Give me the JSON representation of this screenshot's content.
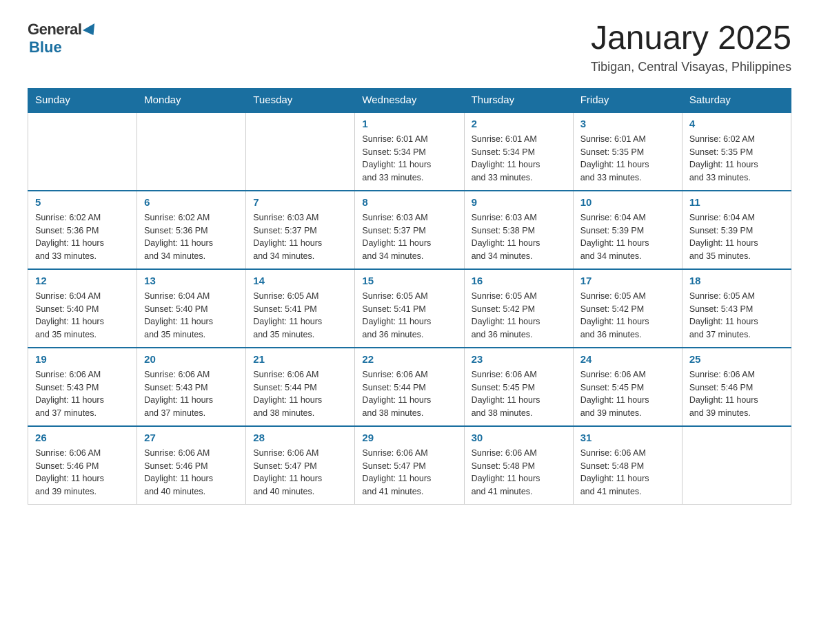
{
  "logo": {
    "general": "General",
    "blue": "Blue"
  },
  "header": {
    "title": "January 2025",
    "subtitle": "Tibigan, Central Visayas, Philippines"
  },
  "days_of_week": [
    "Sunday",
    "Monday",
    "Tuesday",
    "Wednesday",
    "Thursday",
    "Friday",
    "Saturday"
  ],
  "weeks": [
    [
      {
        "day": "",
        "info": ""
      },
      {
        "day": "",
        "info": ""
      },
      {
        "day": "",
        "info": ""
      },
      {
        "day": "1",
        "info": "Sunrise: 6:01 AM\nSunset: 5:34 PM\nDaylight: 11 hours\nand 33 minutes."
      },
      {
        "day": "2",
        "info": "Sunrise: 6:01 AM\nSunset: 5:34 PM\nDaylight: 11 hours\nand 33 minutes."
      },
      {
        "day": "3",
        "info": "Sunrise: 6:01 AM\nSunset: 5:35 PM\nDaylight: 11 hours\nand 33 minutes."
      },
      {
        "day": "4",
        "info": "Sunrise: 6:02 AM\nSunset: 5:35 PM\nDaylight: 11 hours\nand 33 minutes."
      }
    ],
    [
      {
        "day": "5",
        "info": "Sunrise: 6:02 AM\nSunset: 5:36 PM\nDaylight: 11 hours\nand 33 minutes."
      },
      {
        "day": "6",
        "info": "Sunrise: 6:02 AM\nSunset: 5:36 PM\nDaylight: 11 hours\nand 34 minutes."
      },
      {
        "day": "7",
        "info": "Sunrise: 6:03 AM\nSunset: 5:37 PM\nDaylight: 11 hours\nand 34 minutes."
      },
      {
        "day": "8",
        "info": "Sunrise: 6:03 AM\nSunset: 5:37 PM\nDaylight: 11 hours\nand 34 minutes."
      },
      {
        "day": "9",
        "info": "Sunrise: 6:03 AM\nSunset: 5:38 PM\nDaylight: 11 hours\nand 34 minutes."
      },
      {
        "day": "10",
        "info": "Sunrise: 6:04 AM\nSunset: 5:39 PM\nDaylight: 11 hours\nand 34 minutes."
      },
      {
        "day": "11",
        "info": "Sunrise: 6:04 AM\nSunset: 5:39 PM\nDaylight: 11 hours\nand 35 minutes."
      }
    ],
    [
      {
        "day": "12",
        "info": "Sunrise: 6:04 AM\nSunset: 5:40 PM\nDaylight: 11 hours\nand 35 minutes."
      },
      {
        "day": "13",
        "info": "Sunrise: 6:04 AM\nSunset: 5:40 PM\nDaylight: 11 hours\nand 35 minutes."
      },
      {
        "day": "14",
        "info": "Sunrise: 6:05 AM\nSunset: 5:41 PM\nDaylight: 11 hours\nand 35 minutes."
      },
      {
        "day": "15",
        "info": "Sunrise: 6:05 AM\nSunset: 5:41 PM\nDaylight: 11 hours\nand 36 minutes."
      },
      {
        "day": "16",
        "info": "Sunrise: 6:05 AM\nSunset: 5:42 PM\nDaylight: 11 hours\nand 36 minutes."
      },
      {
        "day": "17",
        "info": "Sunrise: 6:05 AM\nSunset: 5:42 PM\nDaylight: 11 hours\nand 36 minutes."
      },
      {
        "day": "18",
        "info": "Sunrise: 6:05 AM\nSunset: 5:43 PM\nDaylight: 11 hours\nand 37 minutes."
      }
    ],
    [
      {
        "day": "19",
        "info": "Sunrise: 6:06 AM\nSunset: 5:43 PM\nDaylight: 11 hours\nand 37 minutes."
      },
      {
        "day": "20",
        "info": "Sunrise: 6:06 AM\nSunset: 5:43 PM\nDaylight: 11 hours\nand 37 minutes."
      },
      {
        "day": "21",
        "info": "Sunrise: 6:06 AM\nSunset: 5:44 PM\nDaylight: 11 hours\nand 38 minutes."
      },
      {
        "day": "22",
        "info": "Sunrise: 6:06 AM\nSunset: 5:44 PM\nDaylight: 11 hours\nand 38 minutes."
      },
      {
        "day": "23",
        "info": "Sunrise: 6:06 AM\nSunset: 5:45 PM\nDaylight: 11 hours\nand 38 minutes."
      },
      {
        "day": "24",
        "info": "Sunrise: 6:06 AM\nSunset: 5:45 PM\nDaylight: 11 hours\nand 39 minutes."
      },
      {
        "day": "25",
        "info": "Sunrise: 6:06 AM\nSunset: 5:46 PM\nDaylight: 11 hours\nand 39 minutes."
      }
    ],
    [
      {
        "day": "26",
        "info": "Sunrise: 6:06 AM\nSunset: 5:46 PM\nDaylight: 11 hours\nand 39 minutes."
      },
      {
        "day": "27",
        "info": "Sunrise: 6:06 AM\nSunset: 5:46 PM\nDaylight: 11 hours\nand 40 minutes."
      },
      {
        "day": "28",
        "info": "Sunrise: 6:06 AM\nSunset: 5:47 PM\nDaylight: 11 hours\nand 40 minutes."
      },
      {
        "day": "29",
        "info": "Sunrise: 6:06 AM\nSunset: 5:47 PM\nDaylight: 11 hours\nand 41 minutes."
      },
      {
        "day": "30",
        "info": "Sunrise: 6:06 AM\nSunset: 5:48 PM\nDaylight: 11 hours\nand 41 minutes."
      },
      {
        "day": "31",
        "info": "Sunrise: 6:06 AM\nSunset: 5:48 PM\nDaylight: 11 hours\nand 41 minutes."
      },
      {
        "day": "",
        "info": ""
      }
    ]
  ]
}
